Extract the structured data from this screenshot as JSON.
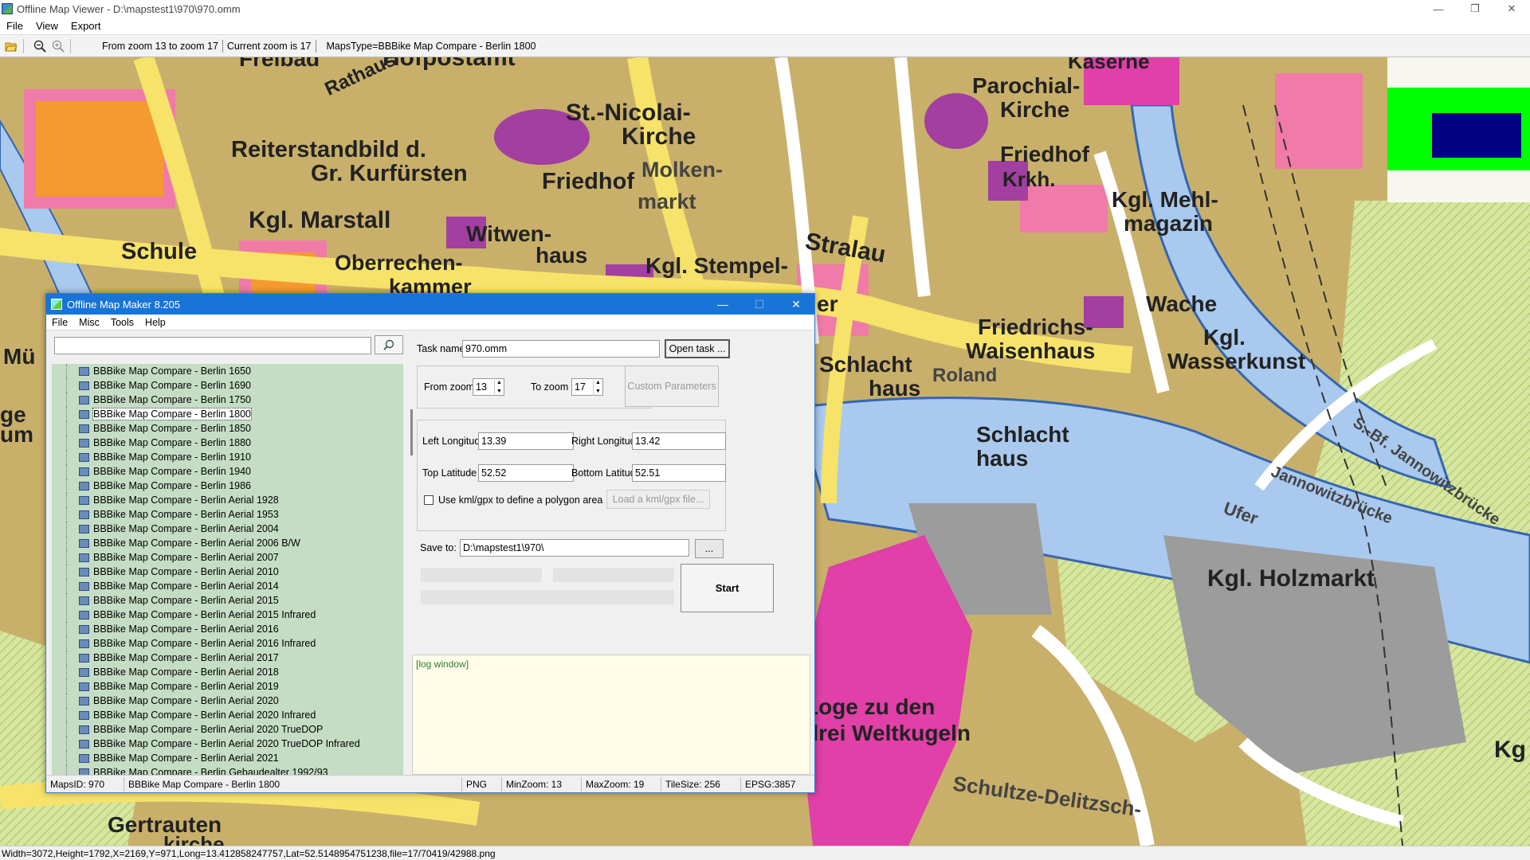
{
  "window": {
    "title": "Offline Map Viewer - D:\\mapstest1\\970\\970.omm",
    "minimize": "—",
    "maximize": "❐",
    "close": "✕"
  },
  "menu": [
    "File",
    "View",
    "Export"
  ],
  "toolbar": {
    "open_icon": "folder-open-icon",
    "zoom_out_icon": "zoom-out-icon",
    "zoom_in_icon": "zoom-in-icon",
    "zoom_range": "From zoom 13 to zoom 17",
    "current_zoom": "Current zoom is 17",
    "maps_type": "MapsType=BBBike Map Compare - Berlin 1800"
  },
  "map_labels": [
    "Freibad",
    "Hofpostamt",
    "Kaserne",
    "Parochial-",
    "Kirche",
    "Rathaus",
    "St.-Nicolai-",
    "Kirche",
    "Reiterstandbild d.",
    "Gr. Kurfürsten",
    "Friedhof",
    "Molken-",
    "markt",
    "Friedhof",
    "Krkh.",
    "Kgl. Mehl-",
    "magazin",
    "Kgl. Marstall",
    "Schule",
    "Witwen-",
    "haus",
    "Oberrechen-",
    "kammer",
    "Kgl. Stempel-",
    "Stralau",
    "er",
    "Friedrichs-",
    "Waisenhaus",
    "Wache",
    "Kgl.",
    "Wasserkunst",
    "Schlacht",
    "haus",
    "Schlacht",
    "haus",
    "Kgl. Holzmarkt",
    "Loge zu den",
    "drei Weltkugeln",
    "Gertrauten",
    "kirche",
    "Schultze-Delitzsch-",
    "Jannowitzbrücke",
    "S.-Bf. Jannowitzbrücke",
    "Ufer",
    "Kg",
    "Mü",
    "ge",
    "um",
    "Roland"
  ],
  "status": "Width=3072,Height=1792,X=2169,Y=971,Long=13.412858247757,Lat=52.5148954751238,file=17/70419/42988.png",
  "dialog": {
    "title": "Offline Map Maker 8.205",
    "menu": [
      "File",
      "Misc",
      "Tools",
      "Help"
    ],
    "search_value": "",
    "search_icon": "magnifier-icon",
    "tree_items": [
      "BBBike Map Compare - Berlin 1650",
      "BBBike Map Compare - Berlin 1690",
      "BBBike Map Compare - Berlin 1750",
      "BBBike Map Compare - Berlin 1800",
      "BBBike Map Compare - Berlin 1850",
      "BBBike Map Compare - Berlin 1880",
      "BBBike Map Compare - Berlin 1910",
      "BBBike Map Compare - Berlin 1940",
      "BBBike Map Compare - Berlin 1986",
      "BBBike Map Compare - Berlin Aerial 1928",
      "BBBike Map Compare - Berlin Aerial 1953",
      "BBBike Map Compare - Berlin Aerial 2004",
      "BBBike Map Compare - Berlin Aerial 2006 B/W",
      "BBBike Map Compare - Berlin Aerial 2007",
      "BBBike Map Compare - Berlin Aerial 2010",
      "BBBike Map Compare - Berlin Aerial 2014",
      "BBBike Map Compare - Berlin Aerial 2015",
      "BBBike Map Compare - Berlin Aerial 2015 Infrared",
      "BBBike Map Compare - Berlin Aerial 2016",
      "BBBike Map Compare - Berlin Aerial 2016 Infrared",
      "BBBike Map Compare - Berlin Aerial 2017",
      "BBBike Map Compare - Berlin Aerial 2018",
      "BBBike Map Compare - Berlin Aerial 2019",
      "BBBike Map Compare - Berlin Aerial 2020",
      "BBBike Map Compare - Berlin Aerial 2020 Infrared",
      "BBBike Map Compare - Berlin Aerial 2020 TrueDOP",
      "BBBike Map Compare - Berlin Aerial 2020 TrueDOP Infrared",
      "BBBike Map Compare - Berlin Aerial 2021",
      "BBBike Map Compare - Berlin Gebaudealter 1992/93"
    ],
    "selected_index": 3,
    "task_name_label": "Task name",
    "task_name_value": "970.omm",
    "open_task": "Open task ...",
    "from_zoom_label": "From zoom",
    "from_zoom_value": "13",
    "to_zoom_label": "To zoom",
    "to_zoom_value": "17",
    "custom_params": "Custom Parameters",
    "left_lon_label": "Left Longitude",
    "left_lon_value": "13.39",
    "right_lon_label": "Right Longitude",
    "right_lon_value": "13.42",
    "top_lat_label": "Top Latitude",
    "top_lat_value": "52.52",
    "bottom_lat_label": "Bottom Latitude",
    "bottom_lat_value": "52.51",
    "kml_label": "Use kml/gpx to define a polygon area",
    "kml_button": "Load a kml/gpx file...",
    "save_to_label": "Save to:",
    "save_to_value": "D:\\mapstest1\\970\\",
    "browse": "...",
    "start": "Start",
    "log": "[log window]",
    "status": {
      "maps_id": "MapsID: 970",
      "map_name": "BBBike Map Compare - Berlin 1800",
      "format": "PNG",
      "min_zoom": "MinZoom: 13",
      "max_zoom": "MaxZoom: 19",
      "tile_size": "TileSize: 256",
      "epsg": "EPSG:3857"
    }
  },
  "colors": {
    "dialog_title": "#1874d6",
    "tree_bg": "#c4ddc4",
    "log_bg": "#fffde7",
    "overview_green": "#00ff00",
    "overview_navy": "#000080",
    "map_tan": "#c9b06a",
    "map_river": "#a9c9ee",
    "map_pink": "#f07aa8",
    "map_magenta": "#e040a8"
  }
}
